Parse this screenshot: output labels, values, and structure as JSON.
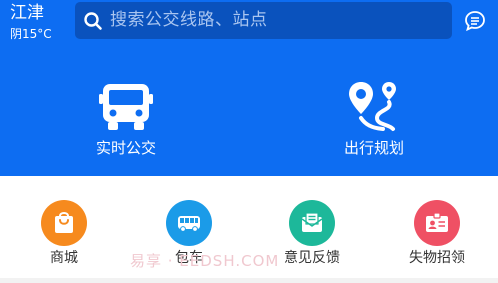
{
  "location": {
    "city": "江津",
    "weather": "阴15°C"
  },
  "search": {
    "placeholder": "搜索公交线路、站点"
  },
  "main_actions": {
    "bus_label": "实时公交",
    "route_label": "出行规划"
  },
  "shortcuts": [
    {
      "label": "商城",
      "color": "#f68a1e"
    },
    {
      "label": "包车",
      "color": "#1b9be8"
    },
    {
      "label": "意见反馈",
      "color": "#1db89a"
    },
    {
      "label": "失物招领",
      "color": "#ef5064"
    }
  ],
  "watermark": "易享 · EEDSH.COM",
  "colors": {
    "header": "#0d6df2",
    "search_bg": "#0a52bd"
  }
}
